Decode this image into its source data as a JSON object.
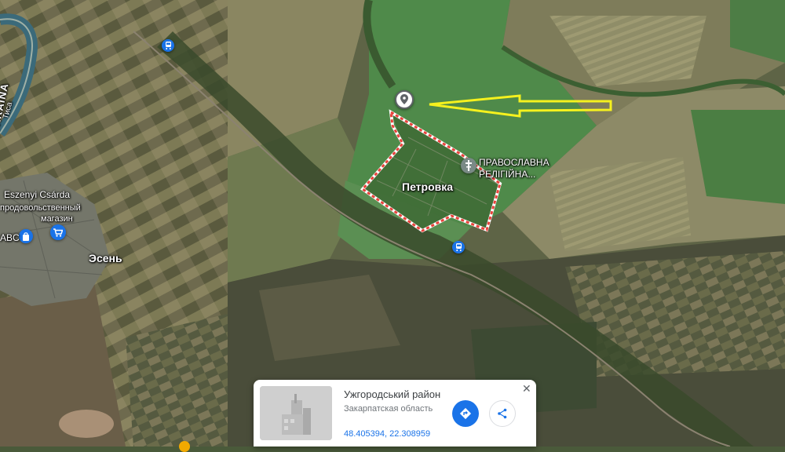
{
  "map": {
    "labels": {
      "town": "Эсень",
      "village": "Петровка",
      "church_line1": "ПРАВОСЛАВНА",
      "church_line2": "РЕЛІГІЙНА...",
      "csarda": "Eszenyi Csárda",
      "store_line1": "продовольственный",
      "store_line2": "магазин",
      "abc": "ABC",
      "ukraina": "UKRAÏNA",
      "tisza": "Тиса"
    },
    "icons": {
      "location_pin": "map-pin-icon",
      "church": "church-icon",
      "store": "shopping-cart-icon",
      "train": "train-icon"
    },
    "colors": {
      "arrow": "#f5f11e",
      "boundary": "#e8423b",
      "train_marker": "#1a73e8",
      "store_marker": "#1a73e8",
      "church_marker": "#7a8a86"
    }
  },
  "info_card": {
    "title": "Ужгородський район",
    "subtitle": "Закарпатская область",
    "coordinates": "48.405394, 22.308959",
    "close": "✕"
  }
}
